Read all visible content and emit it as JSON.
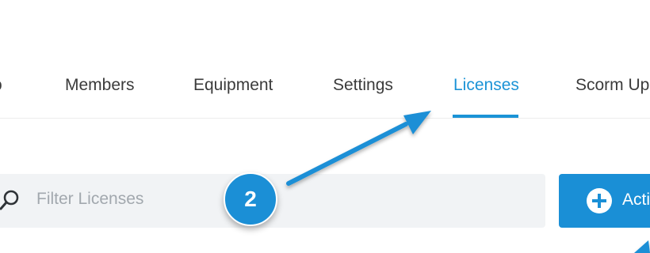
{
  "tabs": [
    {
      "label": "o",
      "active": false
    },
    {
      "label": "Members",
      "active": false
    },
    {
      "label": "Equipment",
      "active": false
    },
    {
      "label": "Settings",
      "active": false
    },
    {
      "label": "Licenses",
      "active": true
    },
    {
      "label": "Scorm Up",
      "active": false
    }
  ],
  "filter": {
    "placeholder": "Filter Licenses",
    "value": "",
    "icon": "search-icon"
  },
  "action_button": {
    "label": "Acti",
    "icon": "plus-circle-icon"
  },
  "annotation": {
    "step_number": "2",
    "arrow_target": "tab-licenses"
  },
  "colors": {
    "accent": "#1b93d6",
    "button": "#1a8fd6",
    "tab_text": "#3b3b3b",
    "placeholder": "#a2a8ae",
    "filter_background": "#f1f3f5"
  }
}
